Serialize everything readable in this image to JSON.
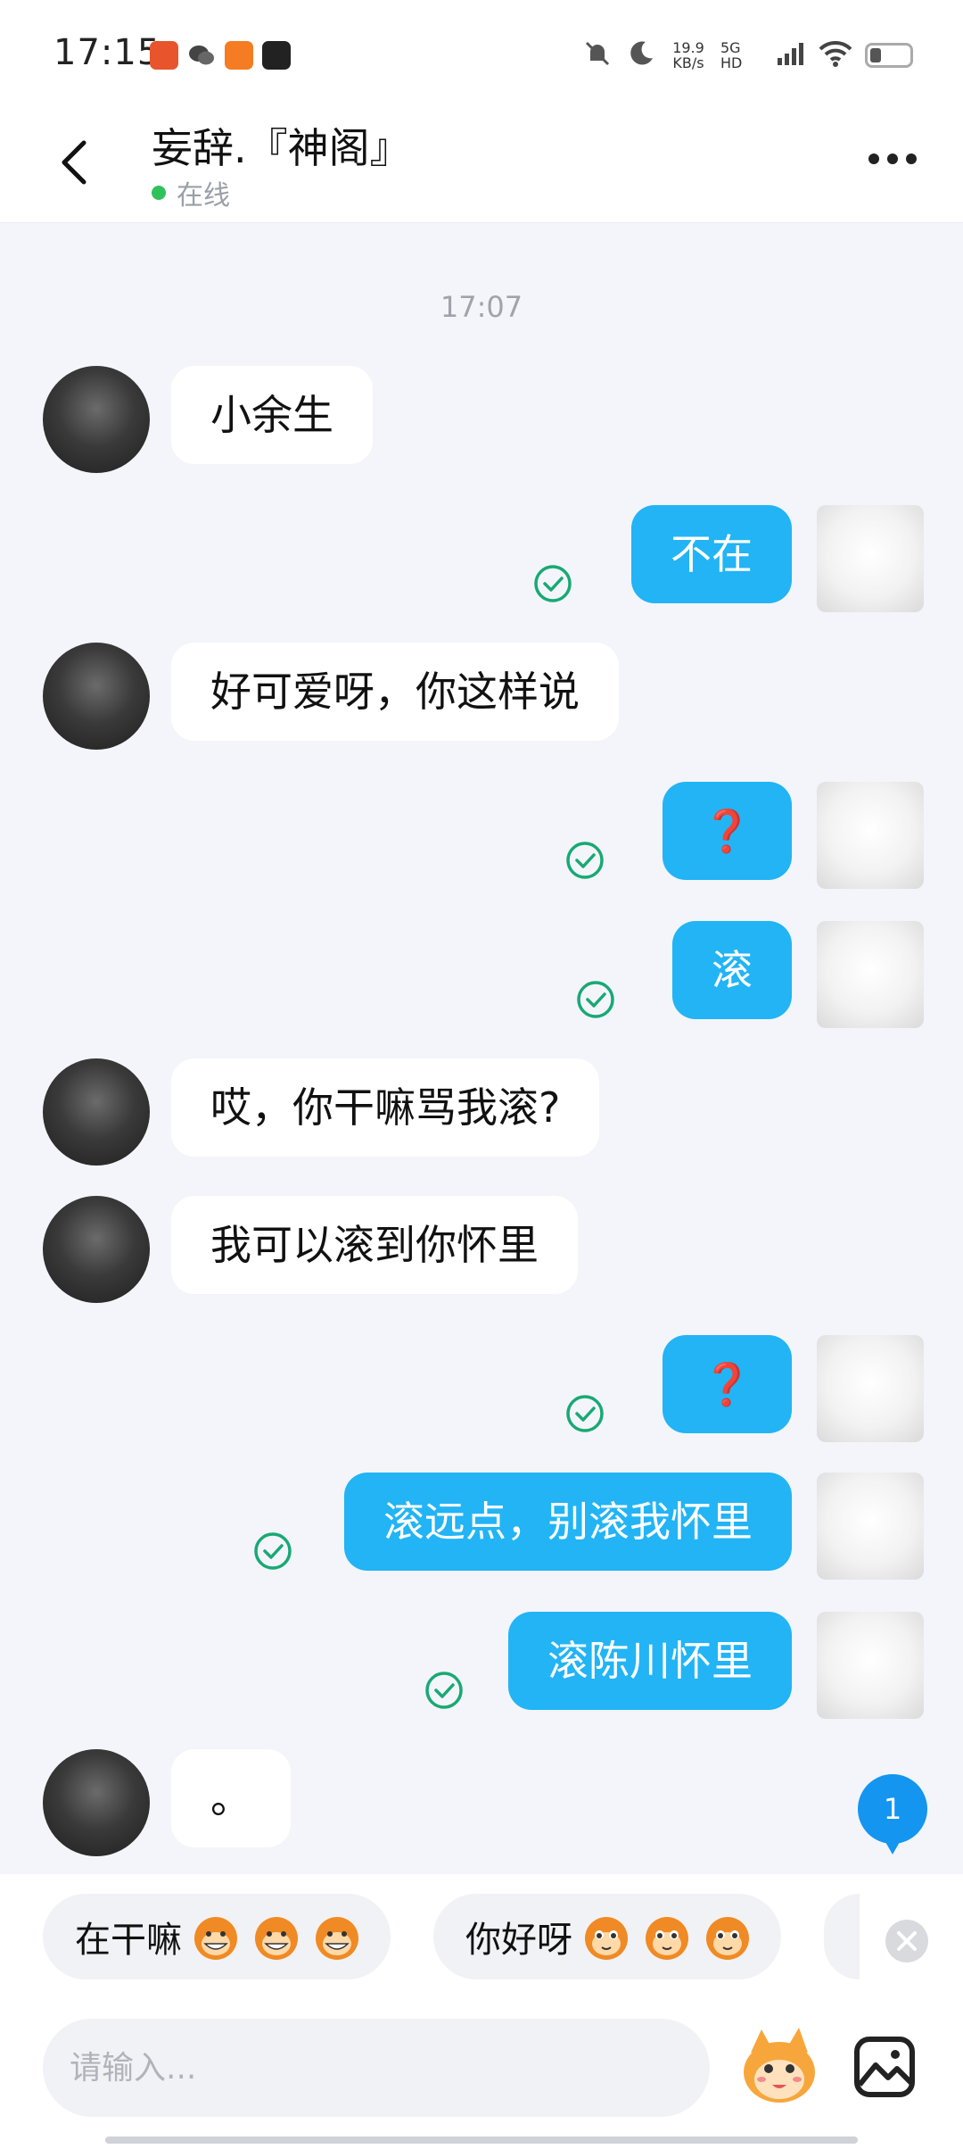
{
  "status_bar": {
    "time": "17:15",
    "app_icons": [
      "orange-app-icon",
      "wechat-icon",
      "233-app-icon",
      "media-app-icon"
    ],
    "net_speed_value": "19.9",
    "net_speed_unit": "KB/s",
    "network": "5G HD"
  },
  "header": {
    "contact_name": "妄辞.『神阁』",
    "status": "在线",
    "colors": {
      "online": "#2fc25b"
    }
  },
  "chat": {
    "timestamp": "17:07",
    "messages": [
      {
        "from": "them",
        "text": "小余生"
      },
      {
        "from": "me",
        "text": "不在",
        "read": true
      },
      {
        "from": "them",
        "text": "好可爱呀，你这样说"
      },
      {
        "from": "me",
        "text": "❓",
        "read": true
      },
      {
        "from": "me",
        "text": "滚",
        "read": true
      },
      {
        "from": "them",
        "text": "哎，你干嘛骂我滚?"
      },
      {
        "from": "them",
        "text": "我可以滚到你怀里"
      },
      {
        "from": "me",
        "text": "❓",
        "read": true
      },
      {
        "from": "me",
        "text": "滚远点，别滚我怀里",
        "read": true
      },
      {
        "from": "me",
        "text": "滚陈川怀里",
        "read": true
      },
      {
        "from": "them",
        "text": "。"
      }
    ],
    "unread_count": "1",
    "colors": {
      "my_bubble": "#22b4f5",
      "their_bubble": "#ffffff",
      "read_check": "#19a974"
    }
  },
  "quick_replies": [
    {
      "text": "在干嘛",
      "emoji": "grinning-monkey-icon"
    },
    {
      "text": "你好呀",
      "emoji": "cute-monkey-icon"
    }
  ],
  "input": {
    "placeholder": "请输入..."
  }
}
